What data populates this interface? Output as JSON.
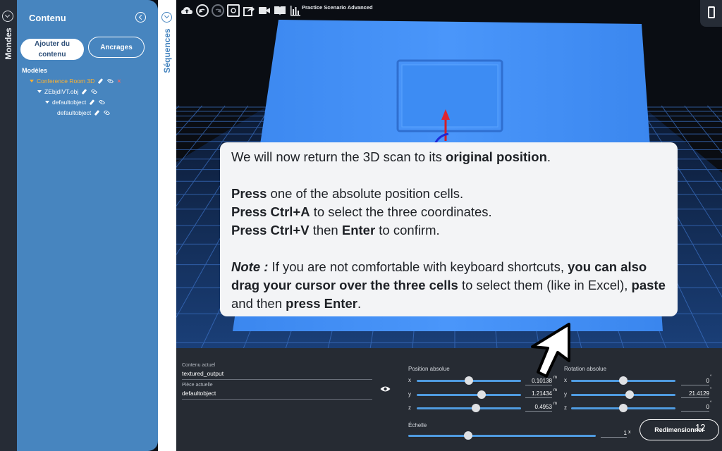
{
  "rail_left": {
    "label": "Mondes"
  },
  "panel": {
    "title": "Contenu",
    "add_content_label": "Ajouter du contenu",
    "anchors_label": "Ancrages",
    "models_title": "Modèles",
    "tree": [
      {
        "label": "Conference Room 3D",
        "active": true
      },
      {
        "label": "ZEbjdIVT.obj",
        "active": false
      },
      {
        "label": "defaultobject",
        "active": false
      },
      {
        "label": "defaultobject",
        "active": false
      }
    ]
  },
  "rail_sequences": {
    "label": "Séquences"
  },
  "toolbar": {
    "scenario_title": "Practice Scenario Advanced",
    "icons": [
      "cloud-upload-icon",
      "undo-icon",
      "redo-icon",
      "focus-icon",
      "share-icon",
      "video-icon",
      "book-icon",
      "chart-icon"
    ]
  },
  "tutorial": {
    "line1_pre": "We will now return the 3D scan to its ",
    "line1_bold": "original position",
    "line1_post": ".",
    "line2_bold": "Press",
    "line2_post": " one of the absolute position cells.",
    "line3_bold": "Press Ctrl+A",
    "line3_post": " to select the three coordinates.",
    "line4_bold1": "Press Ctrl+V",
    "line4_mid": " then ",
    "line4_bold2": "Enter",
    "line4_post": " to confirm.",
    "note_label": "Note :",
    "note_text1": " If you are not comfortable with keyboard shortcuts, ",
    "note_bold1": "you can also drag your cursor over the three cells",
    "note_text2": " to select them (like in Excel), ",
    "note_bold2": "paste",
    "note_text3": " and then ",
    "note_bold3": "press Enter",
    "note_text4": "."
  },
  "properties": {
    "current_content_label": "Contenu actuel",
    "current_content_value": "textured_output",
    "current_piece_label": "Pièce actuelle",
    "current_piece_value": "defaultobject",
    "position_label": "Position absolue",
    "rotation_label": "Rotation absolue",
    "scale_label": "Échelle",
    "position": [
      {
        "axis": "x",
        "value": "0.10138",
        "unit": "m",
        "slider": 0.5
      },
      {
        "axis": "y",
        "value": "1.21434",
        "unit": "m",
        "slider": 0.62
      },
      {
        "axis": "z",
        "value": "0.4953",
        "unit": "m",
        "slider": 0.57
      }
    ],
    "rotation": [
      {
        "axis": "x",
        "value": "0",
        "unit": "°",
        "slider": 0.5
      },
      {
        "axis": "y",
        "value": "21.4129",
        "unit": "°",
        "slider": 0.56
      },
      {
        "axis": "z",
        "value": "0",
        "unit": "°",
        "slider": 0.5
      }
    ],
    "scale": {
      "value": "1",
      "unit": "x",
      "slider": 0.32
    },
    "resize_label": "Redimensionner",
    "page_number": "12"
  },
  "colors": {
    "panel_blue": "#4785bf",
    "highlight_orange": "#ffb22e",
    "model_blue": "#3f8ff5",
    "grid_blue": "#2c5aa0",
    "slider_blue": "#4f9be0"
  }
}
